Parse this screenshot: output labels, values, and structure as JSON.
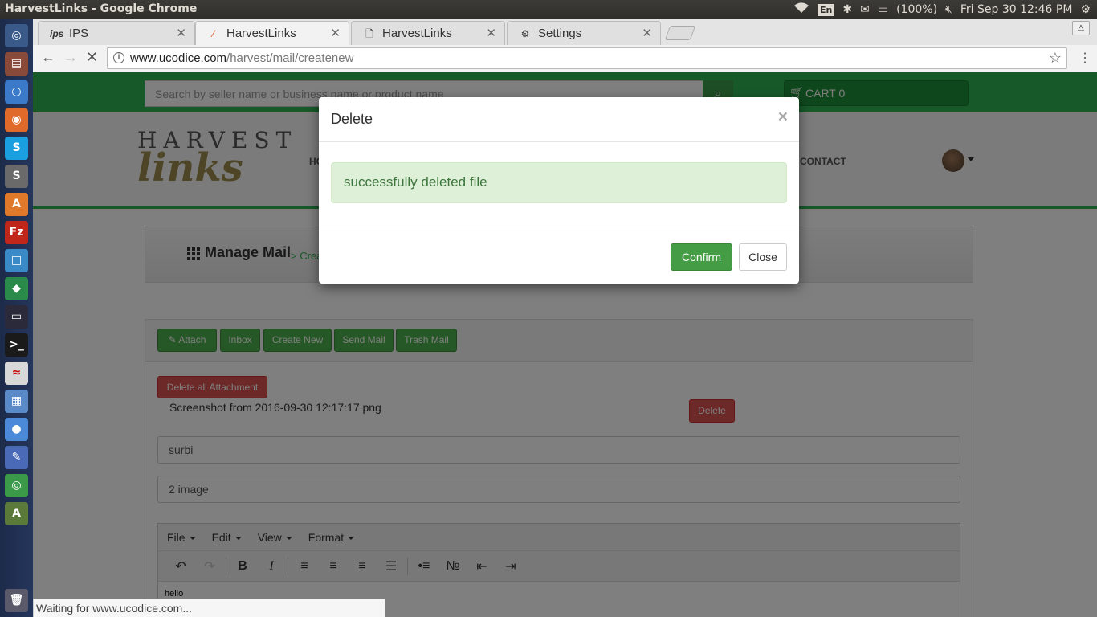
{
  "os": {
    "window_title": "HarvestLinks - Google Chrome",
    "lang": "En",
    "battery": "(100%)",
    "clock": "Fri Sep 30 12:46 PM"
  },
  "tabs": [
    {
      "label": "IPS",
      "favicon": "ips"
    },
    {
      "label": "HarvestLinks",
      "favicon": "harvestlinks-leaf"
    },
    {
      "label": "HarvestLinks",
      "favicon": "page"
    },
    {
      "label": "Settings",
      "favicon": "gear"
    }
  ],
  "address": {
    "host": "www.ucodice.com",
    "path": "/harvest/mail/createnew"
  },
  "site": {
    "search_placeholder": "Search by seller name or business name or product name",
    "cart_label": "CART",
    "cart_count": "0",
    "logo_top": "HARVEST",
    "logo_bottom": "links",
    "nav_home": "HO",
    "nav_contact": "CONTACT",
    "manage_title": "Manage Mail",
    "breadcrumb": "> Crea"
  },
  "mail": {
    "buttons": [
      "Attach",
      "Inbox",
      "Create New",
      "Send Mail",
      "Trash Mail"
    ],
    "delete_all_label": "Delete all Attachment",
    "attachment_name": "Screenshot from 2016-09-30 12:17:17.png",
    "delete_label": "Delete",
    "to_value": "surbi",
    "subject_value": "2 image",
    "editor_menu": [
      "File",
      "Edit",
      "View",
      "Format"
    ],
    "editor_body": "hello"
  },
  "modal": {
    "title": "Delete",
    "close_x": "×",
    "message": "successfully deleted file",
    "confirm_label": "Confirm",
    "close_label": "Close"
  },
  "status": "Waiting for www.ucodice.com...",
  "colors": {
    "brand_green": "#2eb352",
    "danger_red": "#d9534f",
    "alert_bg": "#dff0d8",
    "alert_text": "#3c763d"
  }
}
